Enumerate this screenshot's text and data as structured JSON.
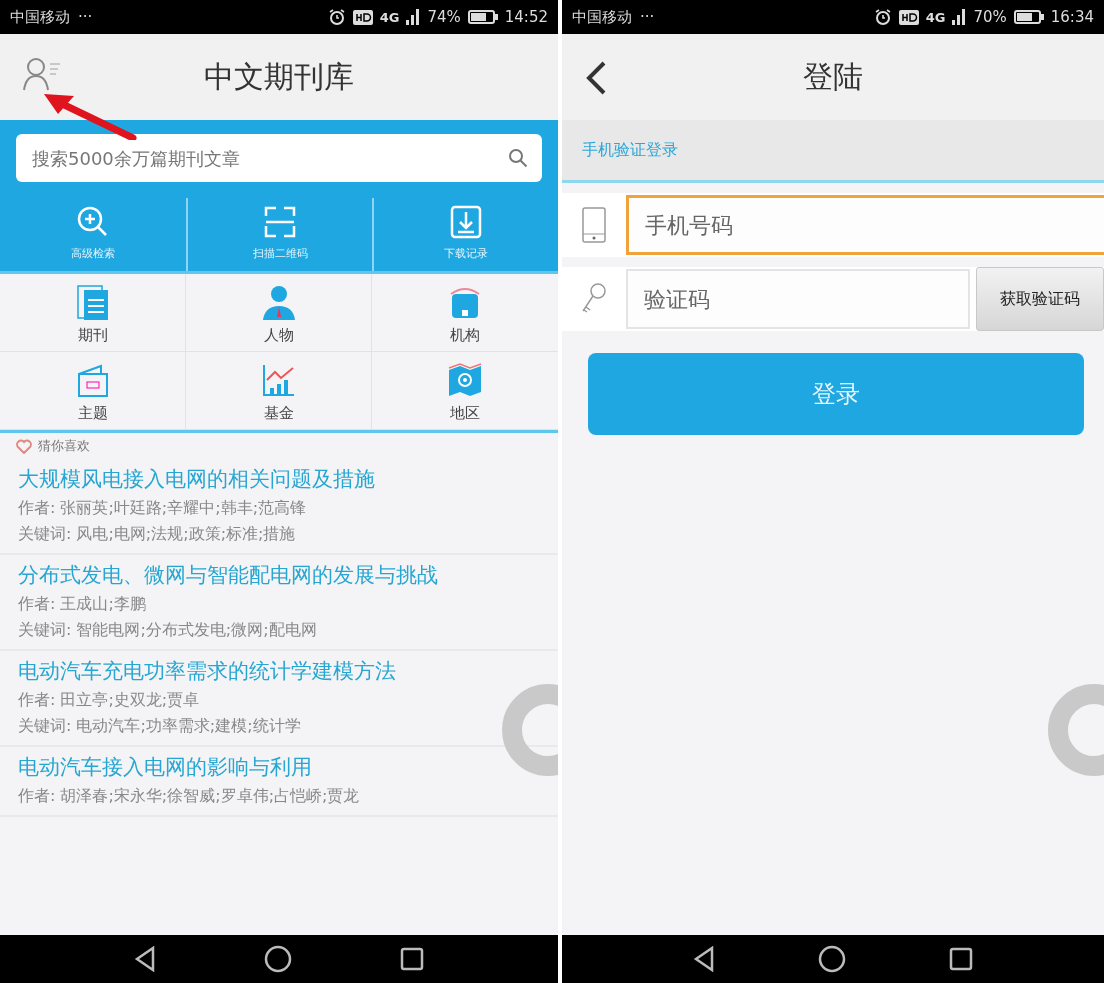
{
  "left_screen": {
    "status_bar": {
      "carrier": "中国移动",
      "more": "···",
      "network": "4G",
      "battery": "74%",
      "time": "14:52"
    },
    "header": {
      "title": "中文期刊库"
    },
    "search": {
      "placeholder": "搜索5000余万篇期刊文章"
    },
    "quick_actions": [
      {
        "label": "高级检索"
      },
      {
        "label": "扫描二维码"
      },
      {
        "label": "下载记录"
      }
    ],
    "categories": [
      {
        "label": "期刊"
      },
      {
        "label": "人物"
      },
      {
        "label": "机构"
      },
      {
        "label": "主题"
      },
      {
        "label": "基金"
      },
      {
        "label": "地区"
      }
    ],
    "recommend": {
      "title": "猜你喜欢"
    },
    "articles": [
      {
        "title": "大规模风电接入电网的相关问题及措施",
        "authors": "作者: 张丽英;叶廷路;辛耀中;韩丰;范高锋",
        "keywords": "关键词: 风电;电网;法规;政策;标准;措施"
      },
      {
        "title": "分布式发电、微网与智能配电网的发展与挑战",
        "authors": "作者: 王成山;李鹏",
        "keywords": "关键词: 智能电网;分布式发电;微网;配电网"
      },
      {
        "title": "电动汽车充电功率需求的统计学建模方法",
        "authors": "作者: 田立亭;史双龙;贾卓",
        "keywords": "关键词: 电动汽车;功率需求;建模;统计学"
      },
      {
        "title": "电动汽车接入电网的影响与利用",
        "authors": "作者: 胡泽春;宋永华;徐智威;罗卓伟;占恺峤;贾龙"
      }
    ]
  },
  "right_screen": {
    "status_bar": {
      "carrier": "中国移动",
      "more": "···",
      "network": "4G",
      "battery": "70%",
      "time": "16:34"
    },
    "header": {
      "title": "登陆"
    },
    "section": {
      "title": "手机验证登录"
    },
    "phone_field": {
      "placeholder": "手机号码",
      "focused": true
    },
    "code_field": {
      "placeholder": "验证码",
      "focused": false
    },
    "get_code_button": {
      "label": "获取验证码"
    },
    "login_button": {
      "label": "登录"
    }
  }
}
